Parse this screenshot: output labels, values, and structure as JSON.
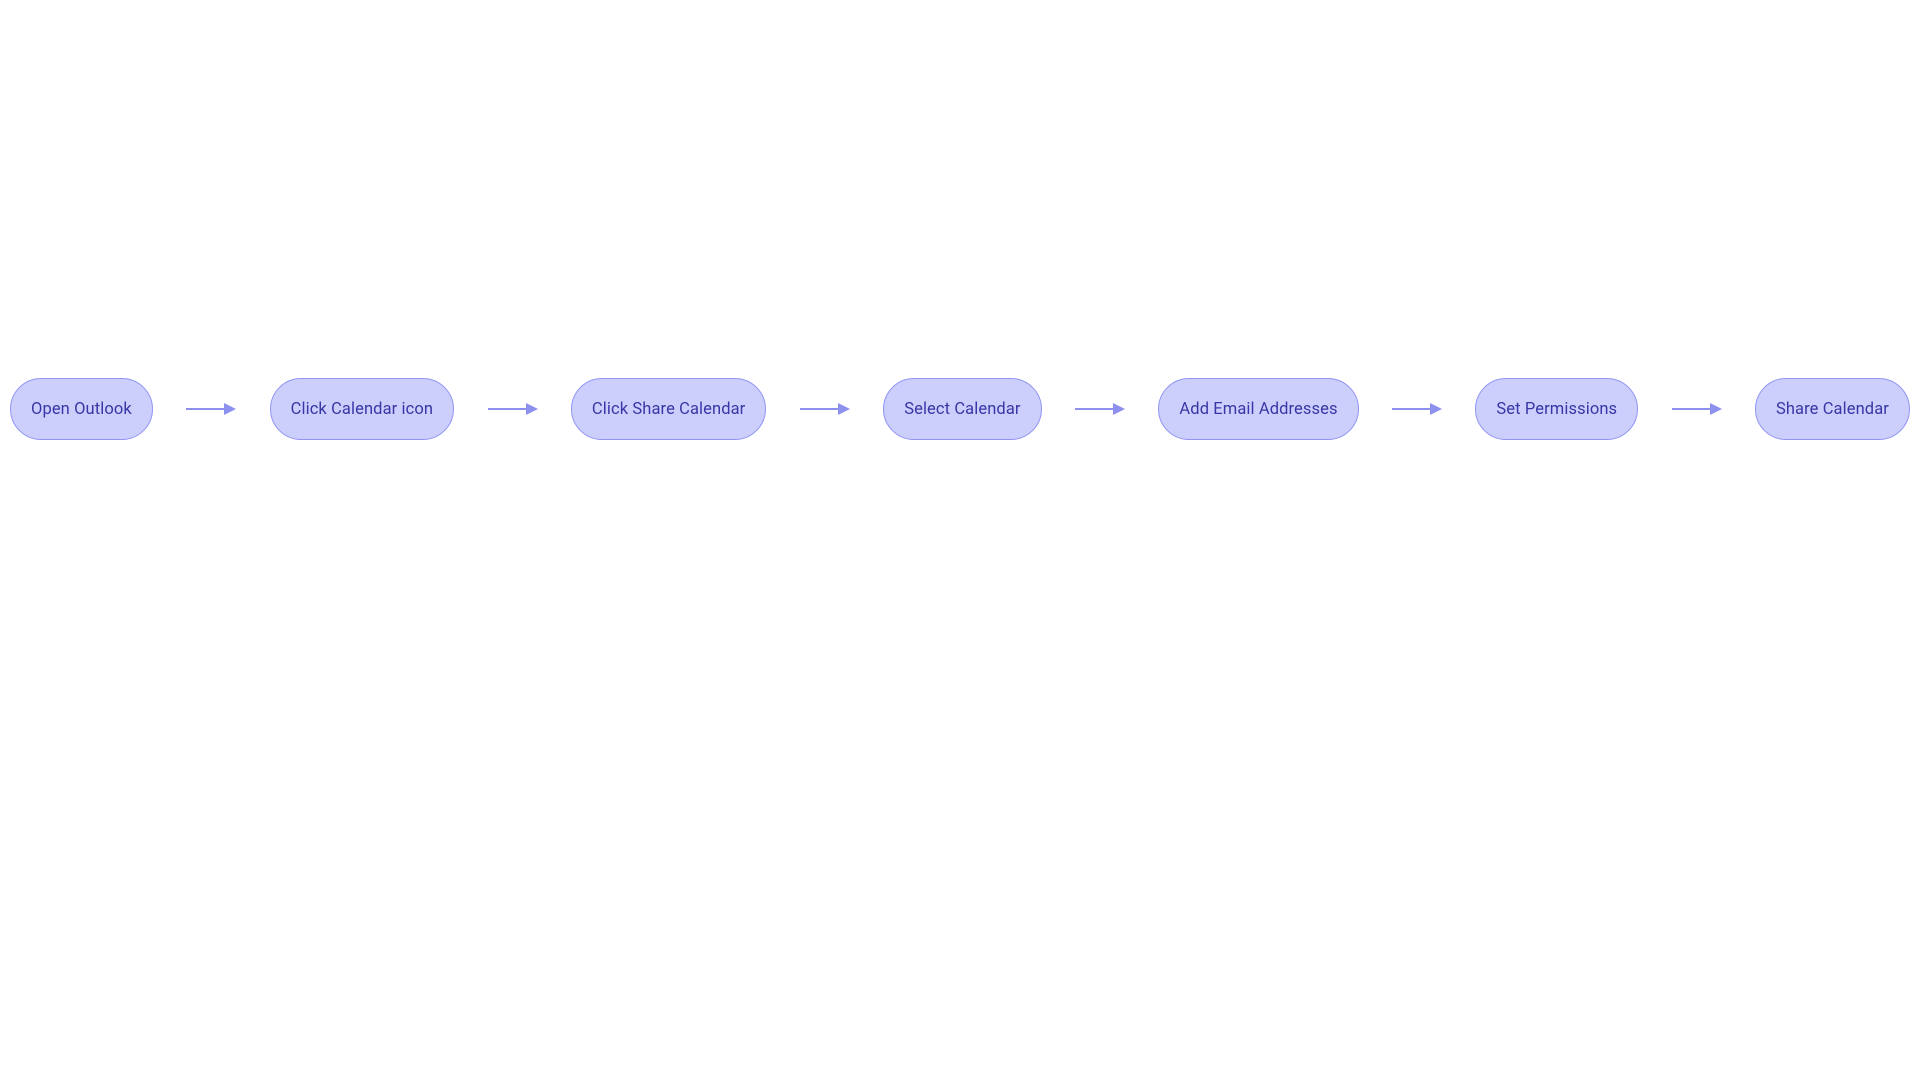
{
  "colors": {
    "node_fill": "#cccefc",
    "node_border": "#9194f2",
    "text": "#3737a6",
    "arrow": "#8d90ef"
  },
  "flow": {
    "nodes": [
      {
        "id": "open-outlook",
        "label": "Open Outlook"
      },
      {
        "id": "click-calendar-icon",
        "label": "Click Calendar icon"
      },
      {
        "id": "click-share-calendar",
        "label": "Click Share Calendar"
      },
      {
        "id": "select-calendar",
        "label": "Select Calendar"
      },
      {
        "id": "add-email-addresses",
        "label": "Add Email Addresses"
      },
      {
        "id": "set-permissions",
        "label": "Set Permissions"
      },
      {
        "id": "share-calendar",
        "label": "Share Calendar"
      }
    ]
  }
}
